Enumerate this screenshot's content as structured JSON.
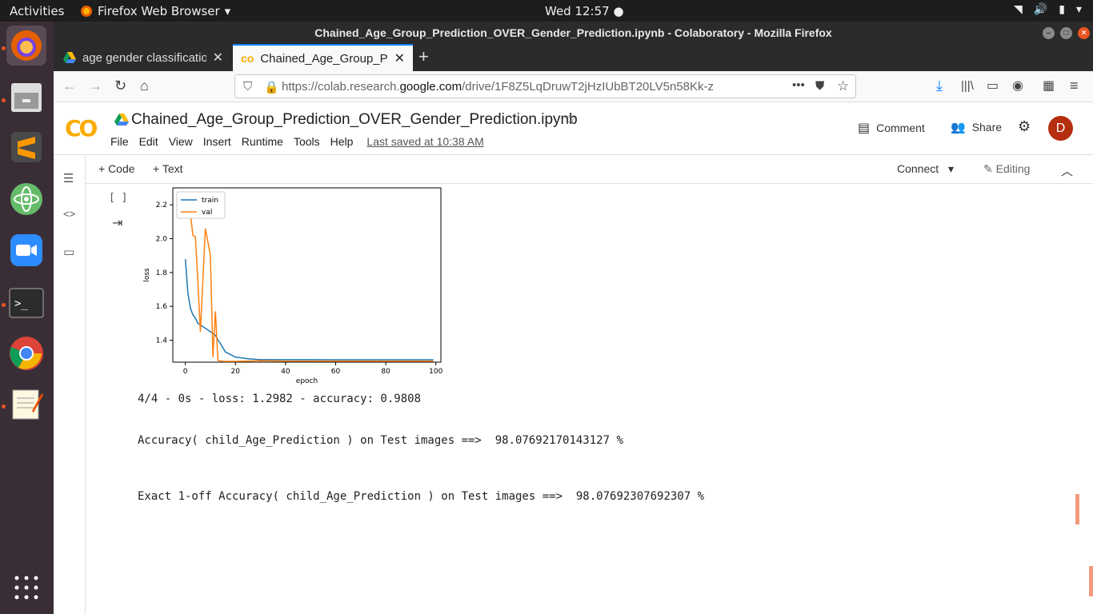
{
  "topbar": {
    "activities": "Activities",
    "app_name": "Firefox Web Browser",
    "clock": "Wed 12:57"
  },
  "window": {
    "title": "Chained_Age_Group_Prediction_OVER_Gender_Prediction.ipynb - Colaboratory - Mozilla Firefox"
  },
  "tabs": [
    {
      "label": "age gender classification"
    },
    {
      "label": "Chained_Age_Group_Pre"
    }
  ],
  "url": {
    "prefix": "https://colab.research.",
    "host": "google.com",
    "suffix": "/drive/1F8Z5LqDruwT2jHzIUbBT20LV5n58Kk-z"
  },
  "colab": {
    "logo": "CO",
    "notebook_title": "Chained_Age_Group_Prediction_OVER_Gender_Prediction.ipynb",
    "menus": [
      "File",
      "Edit",
      "View",
      "Insert",
      "Runtime",
      "Tools",
      "Help"
    ],
    "last_saved": "Last saved at 10:38 AM",
    "comment_label": "Comment",
    "share_label": "Share",
    "avatar_letter": "D"
  },
  "toolbar": {
    "code_label": "+ Code",
    "text_label": "+ Text",
    "connect_label": "Connect",
    "editing_label": "Editing"
  },
  "cell": {
    "bracket": "[ ]",
    "output_lines": [
      "4/4 - 0s - loss: 1.2982 - accuracy: 0.9808",
      "Accuracy( child_Age_Prediction ) on Test images ==>  98.07692170143127 %",
      "Exact 1-off Accuracy( child_Age_Prediction ) on Test images ==>  98.07692307692307 %"
    ]
  },
  "chart_data": {
    "type": "line",
    "xlabel": "epoch",
    "ylabel": "loss",
    "xlim": [
      -5,
      102
    ],
    "ylim": [
      1.27,
      2.3
    ],
    "xticks": [
      0,
      20,
      40,
      60,
      80,
      100
    ],
    "yticks": [
      1.4,
      1.6,
      1.8,
      2.0,
      2.2
    ],
    "legend_position": "top-left",
    "series": [
      {
        "name": "train",
        "color": "#1f77b4",
        "x": [
          0,
          1,
          2,
          3,
          4,
          5,
          6,
          8,
          10,
          12,
          13,
          14,
          16,
          20,
          25,
          30,
          40,
          60,
          80,
          99
        ],
        "y": [
          1.88,
          1.68,
          1.59,
          1.55,
          1.53,
          1.5,
          1.49,
          1.47,
          1.45,
          1.43,
          1.4,
          1.38,
          1.33,
          1.3,
          1.29,
          1.285,
          1.285,
          1.284,
          1.284,
          1.284
        ]
      },
      {
        "name": "val",
        "color": "#ff7f0e",
        "x": [
          1,
          3,
          4,
          5,
          6,
          8,
          10,
          11,
          12,
          13,
          15,
          20,
          30,
          40,
          60,
          80,
          99
        ],
        "y": [
          2.28,
          2.02,
          2.01,
          1.75,
          1.45,
          2.06,
          1.9,
          1.3,
          1.57,
          1.28,
          1.275,
          1.275,
          1.278,
          1.276,
          1.276,
          1.276,
          1.276
        ]
      }
    ]
  }
}
